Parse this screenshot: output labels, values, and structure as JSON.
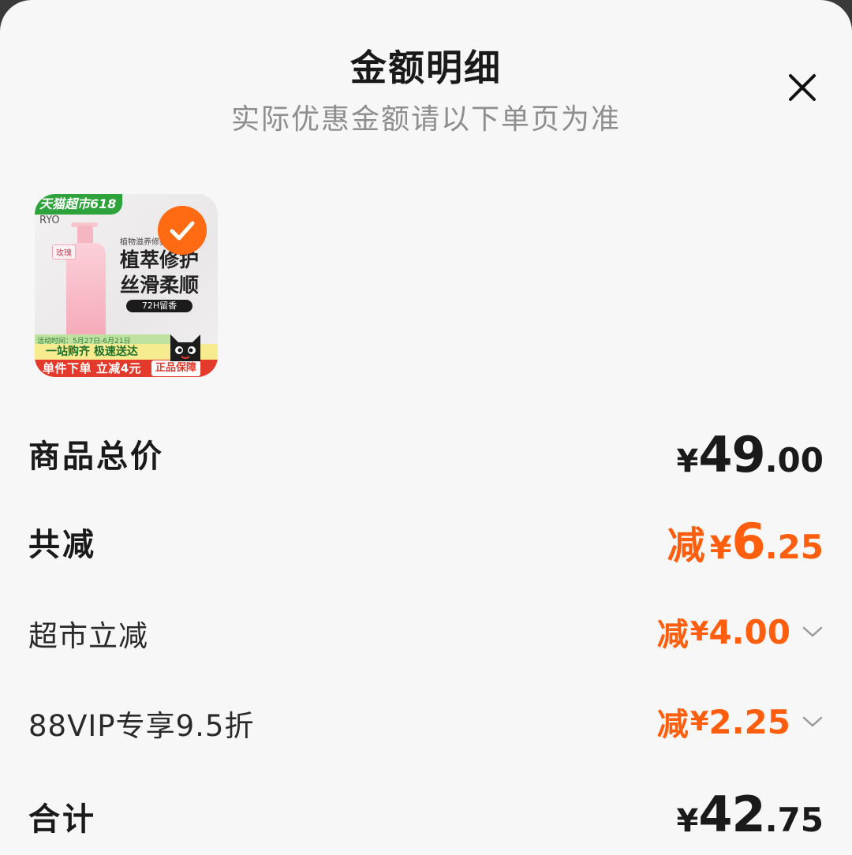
{
  "header": {
    "title": "金额明细",
    "subtitle": "实际优惠金额请以下单页为准",
    "close_icon": "close-icon"
  },
  "product": {
    "tag": "天猫超市618",
    "brand": "RYO",
    "bottle_label": "玫瑰",
    "small_text": "植物滋养修护",
    "headline_1": "植萃修护",
    "headline_2": "丝滑柔顺",
    "pill": "72H留香",
    "strip": "活动时间：5月27日-6月21日",
    "banner_1": "一站购齐 极速送达",
    "banner_2": "单件下单 立减4元",
    "guarantee": "正品保障",
    "selected": true,
    "check_icon": "check-icon",
    "accent": "#ff6a13"
  },
  "rows": {
    "total": {
      "label": "商品总价",
      "currency": "¥",
      "int": "49",
      "dec": ".00"
    },
    "discount": {
      "label": "共减",
      "prefix": "减",
      "currency": "¥",
      "int": "6",
      "dec": ".25"
    },
    "supermarket": {
      "label": "超市立减",
      "prefix": "减",
      "currency": "¥",
      "amount": "4.00"
    },
    "vip": {
      "label": "88VIP专享9.5折",
      "prefix": "减",
      "currency": "¥",
      "amount": "2.25"
    },
    "sum": {
      "label": "合计",
      "currency": "¥",
      "int": "42",
      "dec": ".75"
    }
  },
  "colors": {
    "accent": "#ff5e0e",
    "text": "#1a1a1a",
    "muted": "#8e8e8e"
  }
}
